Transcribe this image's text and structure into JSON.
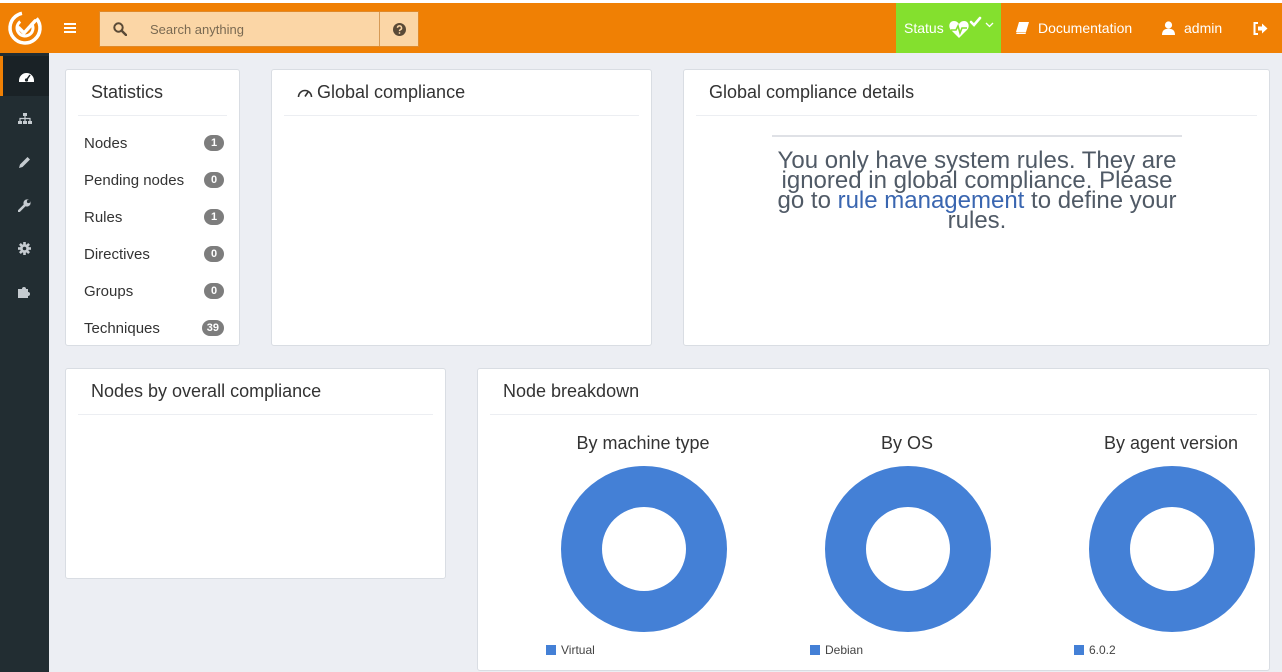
{
  "colors": {
    "brand": "#f08004",
    "status": "#84e02e",
    "sidebar": "#222d32",
    "donut": "#4480d6",
    "link": "#3a66b0"
  },
  "header": {
    "search_placeholder": "Search anything",
    "status_label": "Status",
    "documentation_label": "Documentation",
    "user_label": "admin"
  },
  "sidebar": {
    "items": [
      {
        "icon": "dashboard-icon",
        "active": true
      },
      {
        "icon": "sitemap-icon",
        "active": false
      },
      {
        "icon": "pencil-icon",
        "active": false
      },
      {
        "icon": "wrench-icon",
        "active": false
      },
      {
        "icon": "gear-icon",
        "active": false
      },
      {
        "icon": "puzzle-icon",
        "active": false
      }
    ]
  },
  "statistics": {
    "title": "Statistics",
    "rows": [
      {
        "label": "Nodes",
        "count": "1"
      },
      {
        "label": "Pending nodes",
        "count": "0"
      },
      {
        "label": "Rules",
        "count": "1"
      },
      {
        "label": "Directives",
        "count": "0"
      },
      {
        "label": "Groups",
        "count": "0"
      },
      {
        "label": "Techniques",
        "count": "39"
      }
    ]
  },
  "global_compliance": {
    "title": "Global compliance"
  },
  "compliance_details": {
    "title": "Global compliance details",
    "message_before": "You only have system rules. They are ignored in global compliance. Please go to ",
    "link_text": "rule management",
    "message_after": " to define your rules."
  },
  "nodes_by_compliance": {
    "title": "Nodes by overall compliance"
  },
  "node_breakdown": {
    "title": "Node breakdown",
    "charts": [
      {
        "title": "By machine type",
        "legend": "Virtual"
      },
      {
        "title": "By OS",
        "legend": "Debian"
      },
      {
        "title": "By agent version",
        "legend": "6.0.2"
      }
    ]
  },
  "chart_data": [
    {
      "type": "pie",
      "title": "By machine type",
      "categories": [
        "Virtual"
      ],
      "values": [
        1
      ]
    },
    {
      "type": "pie",
      "title": "By OS",
      "categories": [
        "Debian"
      ],
      "values": [
        1
      ]
    },
    {
      "type": "pie",
      "title": "By agent version",
      "categories": [
        "6.0.2"
      ],
      "values": [
        1
      ]
    }
  ]
}
